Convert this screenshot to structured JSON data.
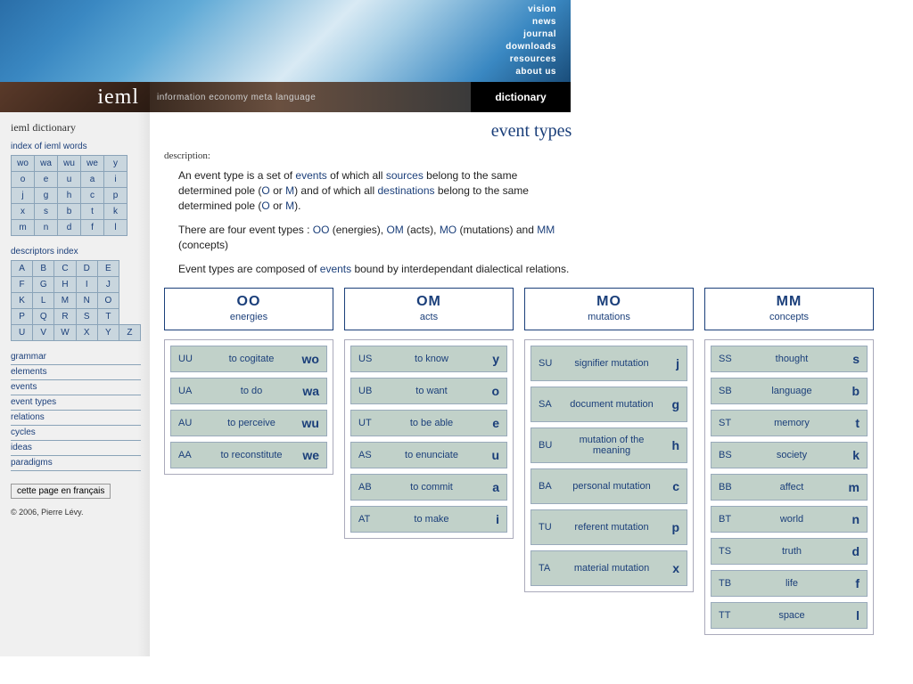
{
  "banner_nav": [
    "vision",
    "news",
    "journal",
    "downloads",
    "resources",
    "about us"
  ],
  "stripe": {
    "logo": "ieml",
    "tagline": "information economy meta language",
    "right": "dictionary"
  },
  "sidebar": {
    "title": "ieml dictionary",
    "index_label": "index of ieml words",
    "index_rows": [
      [
        "wo",
        "wa",
        "wu",
        "we",
        "y"
      ],
      [
        "o",
        "e",
        "u",
        "a",
        "i"
      ],
      [
        "j",
        "g",
        "h",
        "c",
        "p"
      ],
      [
        "x",
        "s",
        "b",
        "t",
        "k"
      ],
      [
        "m",
        "n",
        "d",
        "f",
        "l"
      ]
    ],
    "descriptors_label": "descriptors index",
    "descriptors_rows": [
      [
        "A",
        "B",
        "C",
        "D",
        "E"
      ],
      [
        "F",
        "G",
        "H",
        "I",
        "J"
      ],
      [
        "K",
        "L",
        "M",
        "N",
        "O"
      ],
      [
        "P",
        "Q",
        "R",
        "S",
        "T"
      ],
      [
        "U",
        "V",
        "W",
        "X",
        "Y",
        "Z"
      ]
    ],
    "links": [
      "grammar",
      "elements",
      "events",
      "event types",
      "relations",
      "cycles",
      "ideas",
      "paradigms"
    ],
    "french_button": "cette page en français",
    "copyright": "© 2006, Pierre Lévy."
  },
  "main": {
    "title": "event types",
    "desc_label": "description:",
    "p1a": "An event type is a set of ",
    "p1_link1": "events",
    "p1b": " of which all ",
    "p1_link2": "sources",
    "p1c": " belong to the same determined pole (",
    "p1_link3": "O",
    "p1d": " or ",
    "p1_link4": "M",
    "p1e": ") and of which all ",
    "p1_link5": "destinations",
    "p1f": " belong to the same determined pole (",
    "p1_link6": "O",
    "p1g": " or ",
    "p1_link7": "M",
    "p1h": ").",
    "p2a": "There are four event types : ",
    "p2_l1": "OO",
    "p2b": " (energies), ",
    "p2_l2": "OM",
    "p2c": " (acts), ",
    "p2_l3": "MO",
    "p2d": " (mutations) and ",
    "p2_l4": "MM",
    "p2e": " (concepts)",
    "p3a": "Event types are composed of ",
    "p3_l1": "events",
    "p3b": " bound by interdependant dialectical relations."
  },
  "types": [
    {
      "code": "OO",
      "name": "energies",
      "items": [
        {
          "l": "UU",
          "m": "to cogitate",
          "r": "wo"
        },
        {
          "l": "UA",
          "m": "to do",
          "r": "wa"
        },
        {
          "l": "AU",
          "m": "to perceive",
          "r": "wu"
        },
        {
          "l": "AA",
          "m": "to reconstitute",
          "r": "we"
        }
      ]
    },
    {
      "code": "OM",
      "name": "acts",
      "items": [
        {
          "l": "US",
          "m": "to know",
          "r": "y"
        },
        {
          "l": "UB",
          "m": "to want",
          "r": "o"
        },
        {
          "l": "UT",
          "m": "to be able",
          "r": "e"
        },
        {
          "l": "AS",
          "m": "to enunciate",
          "r": "u"
        },
        {
          "l": "AB",
          "m": "to commit",
          "r": "a"
        },
        {
          "l": "AT",
          "m": "to make",
          "r": "i"
        }
      ]
    },
    {
      "code": "MO",
      "name": "mutations",
      "tall": true,
      "items": [
        {
          "l": "SU",
          "m": "signifier mutation",
          "r": "j"
        },
        {
          "l": "SA",
          "m": "document mutation",
          "r": "g"
        },
        {
          "l": "BU",
          "m": "mutation of the meaning",
          "r": "h"
        },
        {
          "l": "BA",
          "m": "personal mutation",
          "r": "c"
        },
        {
          "l": "TU",
          "m": "referent mutation",
          "r": "p"
        },
        {
          "l": "TA",
          "m": "material mutation",
          "r": "x"
        }
      ]
    },
    {
      "code": "MM",
      "name": "concepts",
      "items": [
        {
          "l": "SS",
          "m": "thought",
          "r": "s"
        },
        {
          "l": "SB",
          "m": "language",
          "r": "b"
        },
        {
          "l": "ST",
          "m": "memory",
          "r": "t"
        },
        {
          "l": "BS",
          "m": "society",
          "r": "k"
        },
        {
          "l": "BB",
          "m": "affect",
          "r": "m"
        },
        {
          "l": "BT",
          "m": "world",
          "r": "n"
        },
        {
          "l": "TS",
          "m": "truth",
          "r": "d"
        },
        {
          "l": "TB",
          "m": "life",
          "r": "f"
        },
        {
          "l": "TT",
          "m": "space",
          "r": "l"
        }
      ]
    }
  ]
}
